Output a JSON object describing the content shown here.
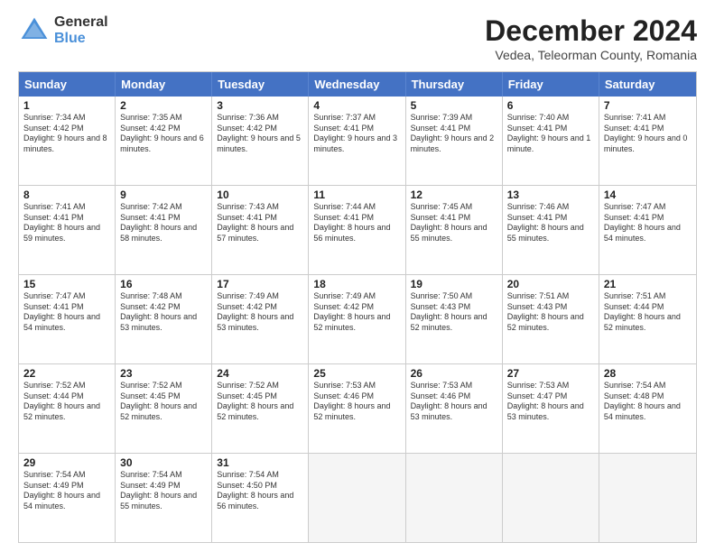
{
  "header": {
    "logo_line1": "General",
    "logo_line2": "Blue",
    "title": "December 2024",
    "subtitle": "Vedea, Teleorman County, Romania"
  },
  "days_of_week": [
    "Sunday",
    "Monday",
    "Tuesday",
    "Wednesday",
    "Thursday",
    "Friday",
    "Saturday"
  ],
  "weeks": [
    [
      {
        "day": "1",
        "rise": "Sunrise: 7:34 AM",
        "set": "Sunset: 4:42 PM",
        "daylight": "Daylight: 9 hours and 8 minutes."
      },
      {
        "day": "2",
        "rise": "Sunrise: 7:35 AM",
        "set": "Sunset: 4:42 PM",
        "daylight": "Daylight: 9 hours and 6 minutes."
      },
      {
        "day": "3",
        "rise": "Sunrise: 7:36 AM",
        "set": "Sunset: 4:42 PM",
        "daylight": "Daylight: 9 hours and 5 minutes."
      },
      {
        "day": "4",
        "rise": "Sunrise: 7:37 AM",
        "set": "Sunset: 4:41 PM",
        "daylight": "Daylight: 9 hours and 3 minutes."
      },
      {
        "day": "5",
        "rise": "Sunrise: 7:39 AM",
        "set": "Sunset: 4:41 PM",
        "daylight": "Daylight: 9 hours and 2 minutes."
      },
      {
        "day": "6",
        "rise": "Sunrise: 7:40 AM",
        "set": "Sunset: 4:41 PM",
        "daylight": "Daylight: 9 hours and 1 minute."
      },
      {
        "day": "7",
        "rise": "Sunrise: 7:41 AM",
        "set": "Sunset: 4:41 PM",
        "daylight": "Daylight: 9 hours and 0 minutes."
      }
    ],
    [
      {
        "day": "8",
        "rise": "Sunrise: 7:41 AM",
        "set": "Sunset: 4:41 PM",
        "daylight": "Daylight: 8 hours and 59 minutes."
      },
      {
        "day": "9",
        "rise": "Sunrise: 7:42 AM",
        "set": "Sunset: 4:41 PM",
        "daylight": "Daylight: 8 hours and 58 minutes."
      },
      {
        "day": "10",
        "rise": "Sunrise: 7:43 AM",
        "set": "Sunset: 4:41 PM",
        "daylight": "Daylight: 8 hours and 57 minutes."
      },
      {
        "day": "11",
        "rise": "Sunrise: 7:44 AM",
        "set": "Sunset: 4:41 PM",
        "daylight": "Daylight: 8 hours and 56 minutes."
      },
      {
        "day": "12",
        "rise": "Sunrise: 7:45 AM",
        "set": "Sunset: 4:41 PM",
        "daylight": "Daylight: 8 hours and 55 minutes."
      },
      {
        "day": "13",
        "rise": "Sunrise: 7:46 AM",
        "set": "Sunset: 4:41 PM",
        "daylight": "Daylight: 8 hours and 55 minutes."
      },
      {
        "day": "14",
        "rise": "Sunrise: 7:47 AM",
        "set": "Sunset: 4:41 PM",
        "daylight": "Daylight: 8 hours and 54 minutes."
      }
    ],
    [
      {
        "day": "15",
        "rise": "Sunrise: 7:47 AM",
        "set": "Sunset: 4:41 PM",
        "daylight": "Daylight: 8 hours and 54 minutes."
      },
      {
        "day": "16",
        "rise": "Sunrise: 7:48 AM",
        "set": "Sunset: 4:42 PM",
        "daylight": "Daylight: 8 hours and 53 minutes."
      },
      {
        "day": "17",
        "rise": "Sunrise: 7:49 AM",
        "set": "Sunset: 4:42 PM",
        "daylight": "Daylight: 8 hours and 53 minutes."
      },
      {
        "day": "18",
        "rise": "Sunrise: 7:49 AM",
        "set": "Sunset: 4:42 PM",
        "daylight": "Daylight: 8 hours and 52 minutes."
      },
      {
        "day": "19",
        "rise": "Sunrise: 7:50 AM",
        "set": "Sunset: 4:43 PM",
        "daylight": "Daylight: 8 hours and 52 minutes."
      },
      {
        "day": "20",
        "rise": "Sunrise: 7:51 AM",
        "set": "Sunset: 4:43 PM",
        "daylight": "Daylight: 8 hours and 52 minutes."
      },
      {
        "day": "21",
        "rise": "Sunrise: 7:51 AM",
        "set": "Sunset: 4:44 PM",
        "daylight": "Daylight: 8 hours and 52 minutes."
      }
    ],
    [
      {
        "day": "22",
        "rise": "Sunrise: 7:52 AM",
        "set": "Sunset: 4:44 PM",
        "daylight": "Daylight: 8 hours and 52 minutes."
      },
      {
        "day": "23",
        "rise": "Sunrise: 7:52 AM",
        "set": "Sunset: 4:45 PM",
        "daylight": "Daylight: 8 hours and 52 minutes."
      },
      {
        "day": "24",
        "rise": "Sunrise: 7:52 AM",
        "set": "Sunset: 4:45 PM",
        "daylight": "Daylight: 8 hours and 52 minutes."
      },
      {
        "day": "25",
        "rise": "Sunrise: 7:53 AM",
        "set": "Sunset: 4:46 PM",
        "daylight": "Daylight: 8 hours and 52 minutes."
      },
      {
        "day": "26",
        "rise": "Sunrise: 7:53 AM",
        "set": "Sunset: 4:46 PM",
        "daylight": "Daylight: 8 hours and 53 minutes."
      },
      {
        "day": "27",
        "rise": "Sunrise: 7:53 AM",
        "set": "Sunset: 4:47 PM",
        "daylight": "Daylight: 8 hours and 53 minutes."
      },
      {
        "day": "28",
        "rise": "Sunrise: 7:54 AM",
        "set": "Sunset: 4:48 PM",
        "daylight": "Daylight: 8 hours and 54 minutes."
      }
    ],
    [
      {
        "day": "29",
        "rise": "Sunrise: 7:54 AM",
        "set": "Sunset: 4:49 PM",
        "daylight": "Daylight: 8 hours and 54 minutes."
      },
      {
        "day": "30",
        "rise": "Sunrise: 7:54 AM",
        "set": "Sunset: 4:49 PM",
        "daylight": "Daylight: 8 hours and 55 minutes."
      },
      {
        "day": "31",
        "rise": "Sunrise: 7:54 AM",
        "set": "Sunset: 4:50 PM",
        "daylight": "Daylight: 8 hours and 56 minutes."
      },
      null,
      null,
      null,
      null
    ]
  ]
}
